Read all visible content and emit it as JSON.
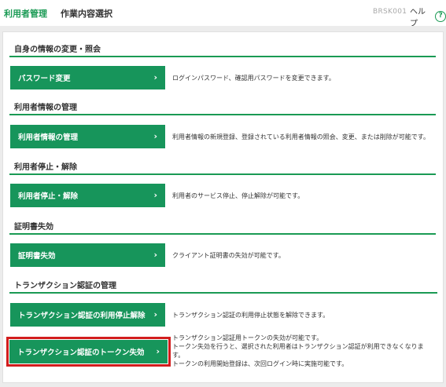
{
  "header": {
    "section_label": "利用者管理",
    "page_title": "作業内容選択",
    "screen_id": "BRSK001",
    "help_label": "ヘルプ",
    "help_icon_glyph": "?"
  },
  "sections": [
    {
      "heading": "自身の情報の変更・照会",
      "button_label": "パスワード変更",
      "description": [
        "ログインパスワード、確認用パスワードを変更できます。"
      ]
    },
    {
      "heading": "利用者情報の管理",
      "button_label": "利用者情報の管理",
      "description": [
        "利用者情報の新規登録、登録されている利用者情報の照会、変更、または削除が可能です。"
      ]
    },
    {
      "heading": "利用者停止・解除",
      "button_label": "利用者停止・解除",
      "description": [
        "利用者のサービス停止、停止解除が可能です。"
      ]
    },
    {
      "heading": "証明書失効",
      "button_label": "証明書失効",
      "description": [
        "クライアント証明書の失効が可能です。"
      ]
    },
    {
      "heading": "トランザクション認証の管理",
      "buttons": [
        {
          "button_label": "トランザクション認証の利用停止解除",
          "description": [
            "トランザクション認証の利用停止状態を解除できます。"
          ]
        },
        {
          "button_label": "トランザクション認証のトークン失効",
          "description": [
            "トランザクション認証用トークンの失効が可能です。",
            "トークン失効を行うと、選択された利用者はトランザクション認証が利用できなくなりま",
            "す。",
            "トークンの利用開始登録は、次回ログイン時に実施可能です。"
          ]
        }
      ]
    }
  ],
  "chevron_glyph": "›",
  "colors": {
    "accent_green": "#17955b",
    "highlight_red": "#d21d1d"
  }
}
